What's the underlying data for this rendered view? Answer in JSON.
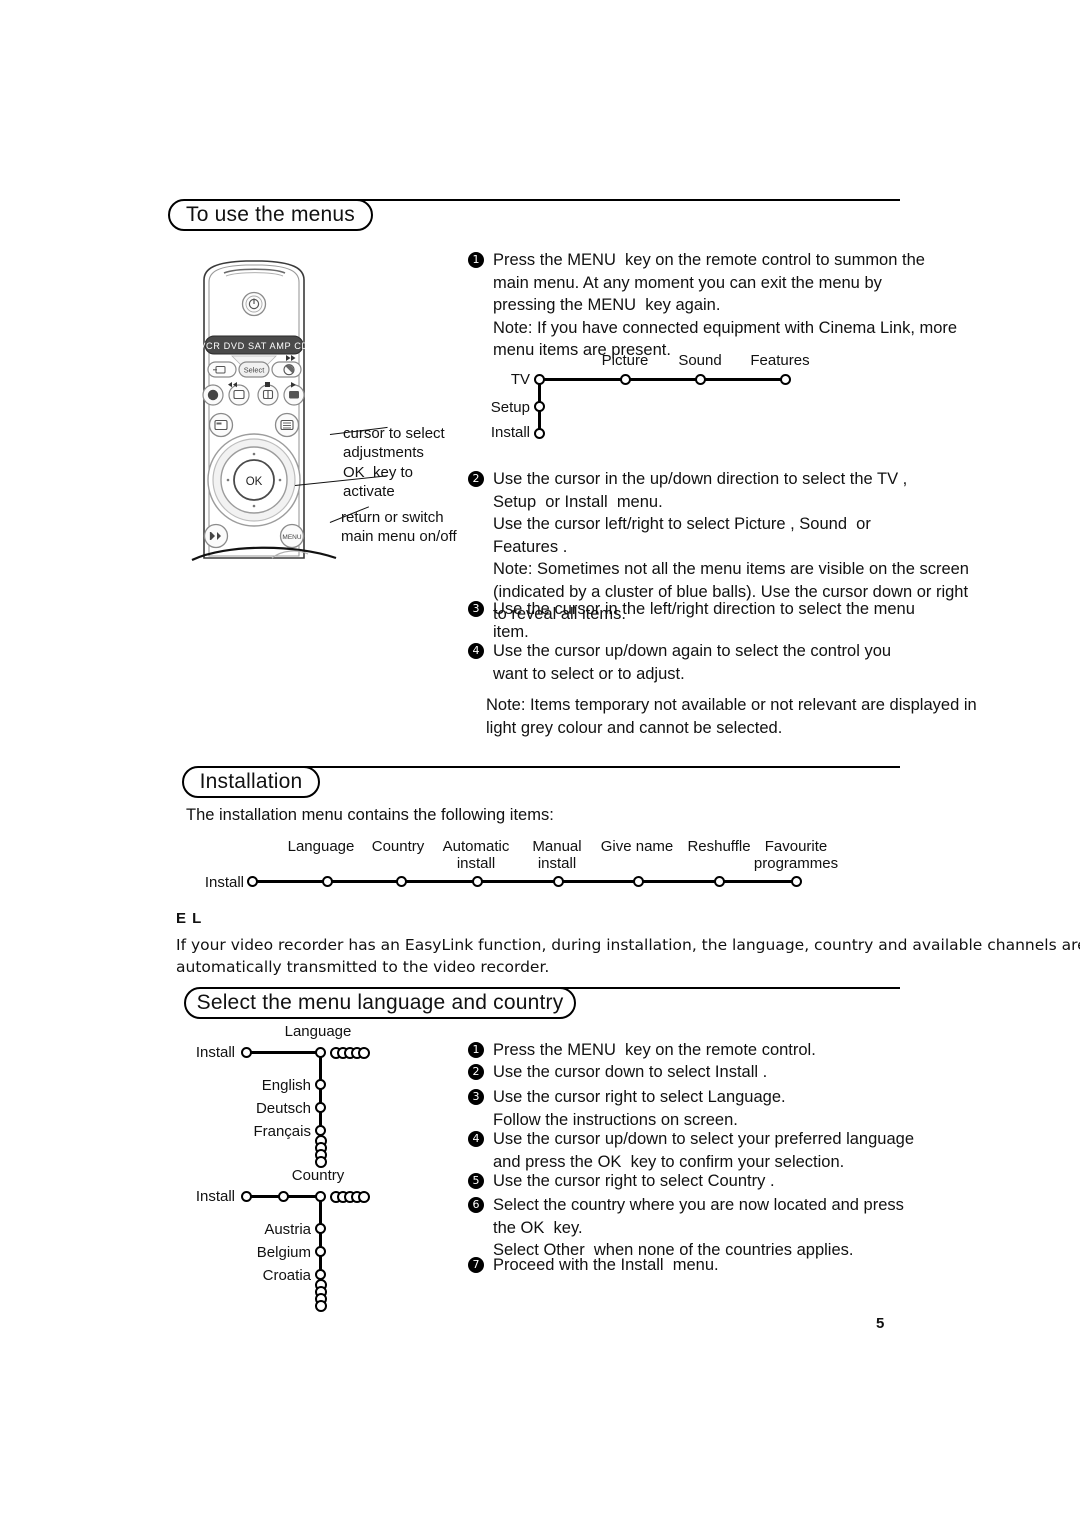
{
  "page": {
    "number": "5"
  },
  "section1": {
    "title": "To use the menus",
    "steps": [
      {
        "num": "1",
        "text": "Press the MENU  key on the remote control to summon the\nmain menu. At any moment you can exit the menu by\npressing the MENU  key again.\nNote: If you have connected equipment with Cinema Link, more\nmenu items are present."
      },
      {
        "num": "2",
        "text": "Use the cursor in the up/down direction to select the TV ,\nSetup  or Install  menu.\nUse the cursor left/right to select Picture , Sound  or\nFeatures .\nNote: Sometimes not all the menu items are visible on the screen\n(indicated by a cluster of blue balls). Use the cursor down or right\nto reveal all items."
      },
      {
        "num": "3",
        "text": "Use the cursor in the left/right direction to select the menu\nitem."
      },
      {
        "num": "4",
        "text": "Use the cursor up/down again to select the control you\nwant to select or to adjust."
      }
    ],
    "final_note": "Note: Items temporary not available or not relevant are displayed in\nlight grey colour and cannot be selected."
  },
  "remote": {
    "mode_bar": "VCR  DVD  SAT  AMP CD",
    "select_label": "Select",
    "ok_label": "OK",
    "menu_label": "MENU",
    "callouts": [
      "cursor to select\nadjustments",
      "OK  key to\nactivate",
      "return or switch\nmain menu on/off"
    ]
  },
  "menu_tree": {
    "root": "TV",
    "vertical_items": [
      "Setup",
      "Install"
    ],
    "horizontal_items": [
      "Picture",
      "Sound",
      "Features"
    ]
  },
  "section2": {
    "title": "Installation",
    "intro": "The installation menu contains the following items:",
    "install_tree": {
      "root": "Install",
      "items": [
        "Language",
        "Country",
        "Automatic\ninstall",
        "Manual\ninstall",
        "Give name",
        "Reshuffle",
        "Favourite\nprogrammes"
      ]
    },
    "easylink_heading": "E L",
    "easylink_text": "If your video recorder has an EasyLink function, during installation, the language, country and available channels are\nautomatically transmitted to the video recorder."
  },
  "section3": {
    "title": "Select the menu language and country",
    "language_tree": {
      "root": "Install",
      "branch": "Language",
      "items": [
        "English",
        "Deutsch",
        "Français"
      ]
    },
    "country_tree": {
      "root": "Install",
      "branch": "Country",
      "items": [
        "Austria",
        "Belgium",
        "Croatia"
      ]
    },
    "steps": [
      {
        "num": "1",
        "text": "Press the MENU  key on the remote control."
      },
      {
        "num": "2",
        "text": "Use the cursor down to select Install ."
      },
      {
        "num": "3",
        "text": "Use the cursor right to select Language.\nFollow the instructions on screen."
      },
      {
        "num": "4",
        "text": "Use the cursor up/down to select your preferred language\nand press the OK  key to confirm your selection."
      },
      {
        "num": "5",
        "text": "Use the cursor right to select Country ."
      },
      {
        "num": "6",
        "text": "Select the country where you are now located and press\nthe OK  key.\nSelect Other  when none of the countries applies."
      },
      {
        "num": "7",
        "text": "Proceed with the Install  menu."
      }
    ]
  }
}
